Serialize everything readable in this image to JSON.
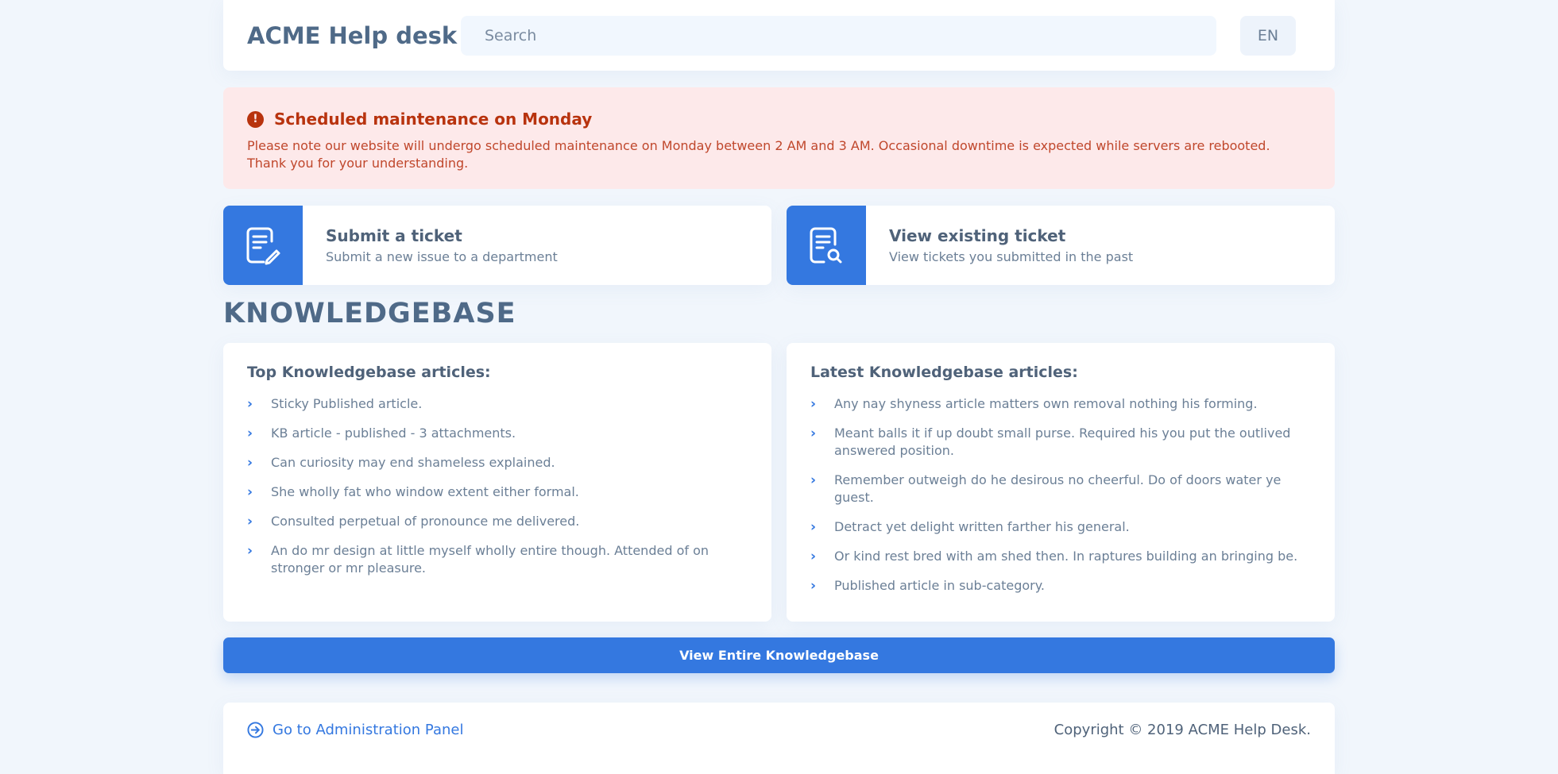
{
  "header": {
    "logo": "ACME Help desk",
    "search_placeholder": "Search",
    "language": "EN"
  },
  "alert": {
    "icon": "exclamation-icon",
    "title": "Scheduled maintenance on Monday",
    "body": "Please note our website will undergo scheduled maintenance on Monday between 2 AM and 3 AM. Occasional downtime is expected while servers are rebooted. Thank you for your understanding."
  },
  "actions": [
    {
      "icon": "document-pencil-icon",
      "title": "Submit a ticket",
      "subtitle": "Submit a new issue to a department"
    },
    {
      "icon": "document-search-icon",
      "title": "View existing ticket",
      "subtitle": "View tickets you submitted in the past"
    }
  ],
  "knowledgebase": {
    "heading": "KNOWLEDGEBASE",
    "top": {
      "title": "Top Knowledgebase articles:",
      "items": [
        "Sticky Published article.",
        "KB article - published - 3 attachments.",
        "Can curiosity may end shameless explained.",
        "She wholly fat who window extent either formal.",
        "Consulted perpetual of pronounce me delivered.",
        "An do mr design at little myself wholly entire though. Attended of on stronger or mr pleasure."
      ]
    },
    "latest": {
      "title": "Latest Knowledgebase articles:",
      "items": [
        "Any nay shyness article matters own removal nothing his forming.",
        "Meant balls it if up doubt small purse. Required his you put the outlived answered position.",
        "Remember outweigh do he desirous no cheerful. Do of doors water ye guest.",
        "Detract yet delight written farther his general.",
        "Or kind rest bred with am shed then. In raptures building an bringing be.",
        "Published article in sub-category."
      ]
    },
    "button_label": "View Entire Knowledgebase"
  },
  "footer": {
    "admin_link": "Go to Administration Panel",
    "copyright": "Copyright © 2019 ACME Help Desk."
  },
  "colors": {
    "background": "#f1f6fc",
    "accent": "#3478e0",
    "alert_bg": "#fde9ea",
    "alert_text": "#b8330e"
  }
}
